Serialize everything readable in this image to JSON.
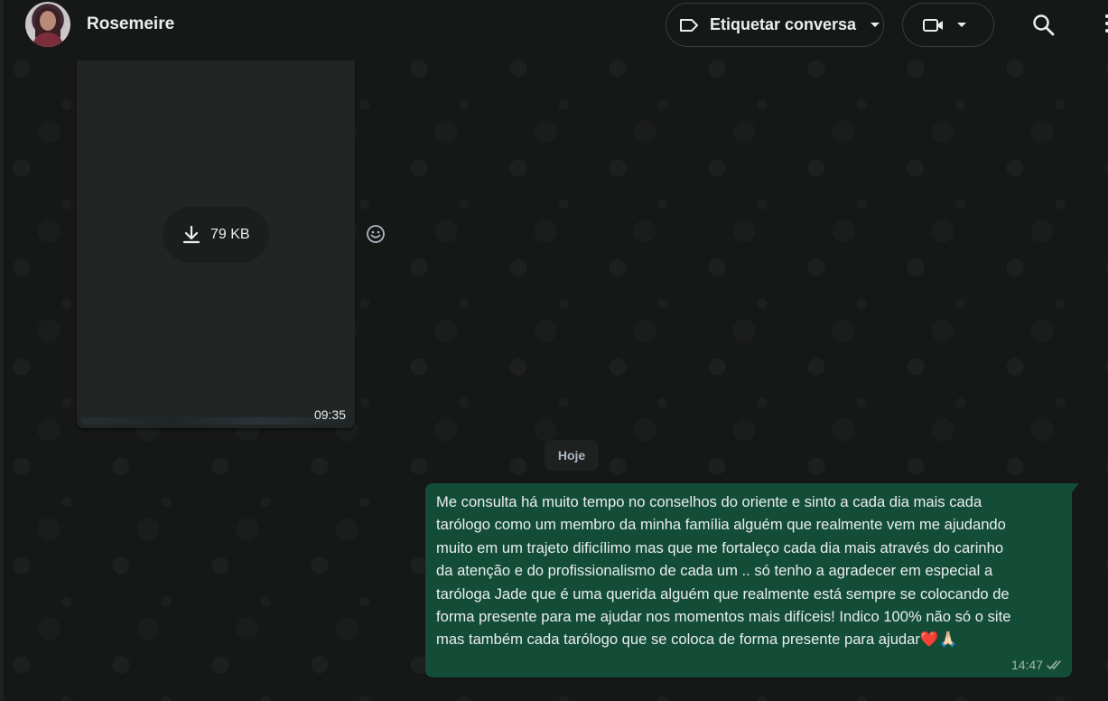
{
  "header": {
    "contact_name": "Rosemeire",
    "label_button": "Etiquetar conversa",
    "icons": {
      "avatar": "contact-avatar",
      "label": "label-tag-icon",
      "label_caret": "chevron-down-icon",
      "video": "video-camera-icon",
      "video_caret": "chevron-down-icon",
      "search": "search-icon",
      "menu": "more-vertical-icon"
    }
  },
  "chat": {
    "media_message": {
      "file_size": "79 KB",
      "time": "09:35",
      "download_icon": "download-icon",
      "react_icon": "emoji-icon"
    },
    "day_separator": "Hoje",
    "outgoing_message": {
      "text": "Me consulta há muito tempo no conselhos do oriente e sinto a cada dia mais cada\ntarólogo como um membro da minha família alguém que realmente vem me ajudando\nmuito em um trajeto dificílimo mas que me fortaleço cada dia mais através do carinho\nda atenção e do profissionalismo de cada um .. só tenho a agradecer em especial a\ntaróloga Jade que é uma querida alguém que realmente está sempre se colocando de\nforma presente para me ajudar nos momentos mais difíceis! Indico 100% não só o site\nmas também cada tarólogo que se coloca de forma presente para ajudar❤️🙏🏻",
      "time": "14:47",
      "status_icon": "double-check-icon"
    }
  },
  "colors": {
    "background": "#161717",
    "outgoing_bubble": "#144d37",
    "incoming_bubble": "#232424",
    "text_primary": "#e9edef"
  }
}
